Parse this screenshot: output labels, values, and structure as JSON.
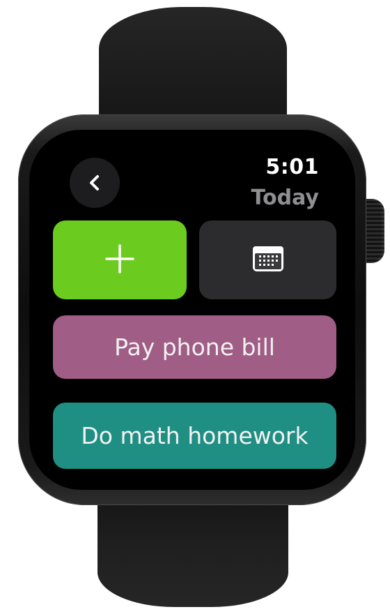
{
  "status": {
    "time": "5:01",
    "title": "Today"
  },
  "navigation": {
    "back_icon": "chevron-left-icon"
  },
  "actions": {
    "add_icon": "plus-icon",
    "add_color": "#6ccb1f",
    "calendar_icon": "calendar-icon"
  },
  "tasks": [
    {
      "label": "Pay phone bill",
      "color": "#a05d85"
    },
    {
      "label": "Do math homework",
      "color": "#1f8f84"
    }
  ]
}
